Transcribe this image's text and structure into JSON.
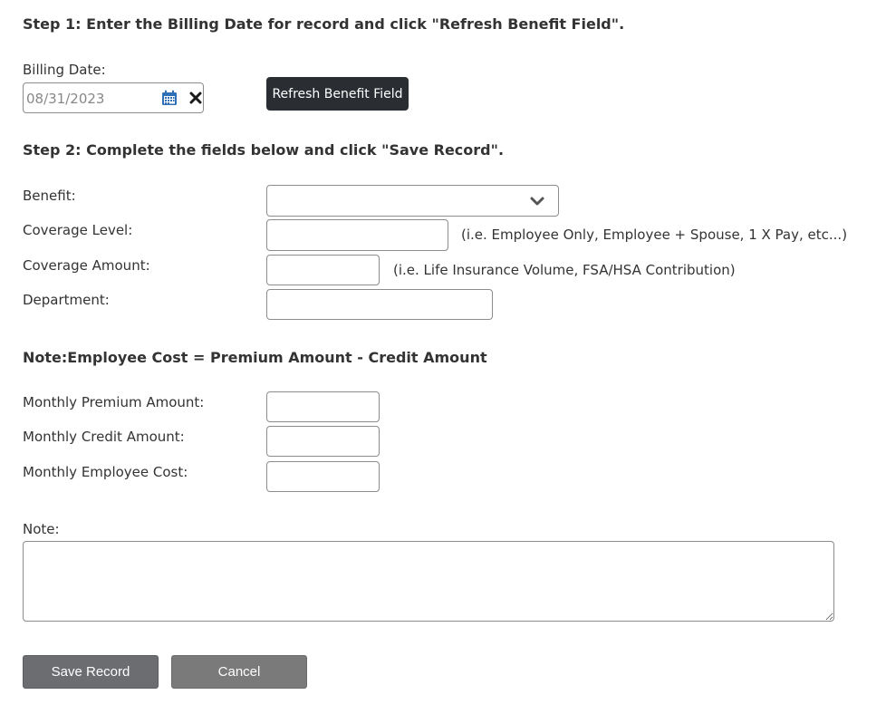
{
  "step1": {
    "heading": "Step 1: Enter the Billing Date for record and click \"Refresh Benefit Field\".",
    "billing_date_label": "Billing Date:",
    "billing_date_value": "08/31/2023",
    "refresh_button_label": "Refresh Benefit Field"
  },
  "step2": {
    "heading": "Step 2: Complete the fields below and click \"Save Record\".",
    "benefit_label": "Benefit:",
    "benefit_selected": "",
    "coverage_level_label": "Coverage Level:",
    "coverage_level_value": "",
    "coverage_level_hint": "(i.e. Employee Only, Employee + Spouse, 1 X Pay, etc...)",
    "coverage_amount_label": "Coverage Amount:",
    "coverage_amount_value": "",
    "coverage_amount_hint": "(i.e. Life Insurance Volume, FSA/HSA Contribution)",
    "department_label": "Department:",
    "department_value": ""
  },
  "cost": {
    "note_heading": "Note:Employee Cost = Premium Amount - Credit Amount",
    "monthly_premium_label": "Monthly Premium Amount:",
    "monthly_premium_value": "",
    "monthly_credit_label": "Monthly Credit Amount:",
    "monthly_credit_value": "",
    "monthly_employee_cost_label": "Monthly Employee Cost:",
    "monthly_employee_cost_value": ""
  },
  "note": {
    "label": "Note:",
    "value": ""
  },
  "actions": {
    "save_label": "Save Record",
    "cancel_label": "Cancel"
  },
  "icons": {
    "calendar": "calendar-icon",
    "clear": "clear-x-icon",
    "dropdown": "chevron-down-icon"
  },
  "colors": {
    "dark_button": "#2a2e33",
    "save_button": "#6b6d71",
    "cancel_button": "#7a7a7a",
    "calendar_icon": "#2f6fb8"
  }
}
